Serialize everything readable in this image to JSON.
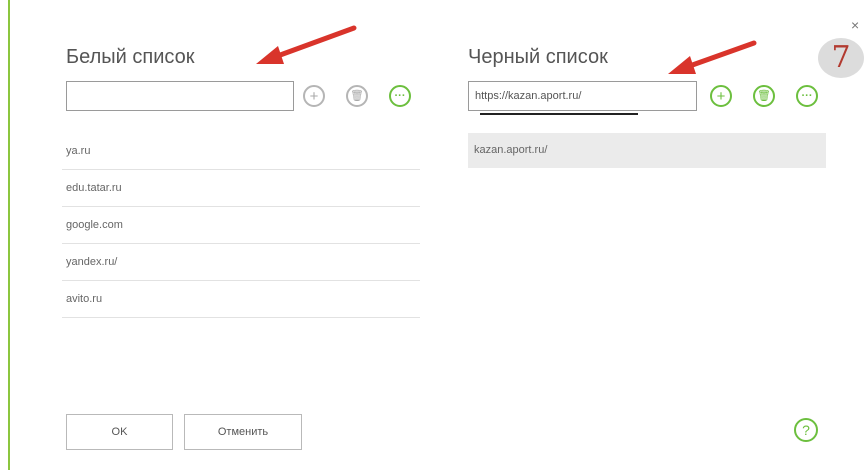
{
  "dialog": {
    "close_glyph": "×",
    "step_number": "7",
    "ok_label": "OK",
    "cancel_label": "Отменить",
    "help_glyph": "?"
  },
  "white_list": {
    "title": "Белый список",
    "input_value": "",
    "add_glyph": "+",
    "delete_glyph": "🗑",
    "more_glyph": "···",
    "items": [
      "ya.ru",
      "edu.tatar.ru",
      "google.com",
      "yandex.ru/",
      "avito.ru"
    ]
  },
  "black_list": {
    "title": "Черный список",
    "input_value": "https://kazan.aport.ru/",
    "add_glyph": "+",
    "delete_glyph": "🗑",
    "more_glyph": "···",
    "items": [
      "kazan.aport.ru/"
    ]
  },
  "icons": {
    "add": "plus-circle-icon",
    "delete": "trash-icon",
    "more": "more-dots-icon",
    "help": "question-circle-icon",
    "close": "close-icon"
  },
  "colors": {
    "accent_green": "#6cbf3e",
    "annotation_red": "#d9342b",
    "selected_row": "#ebebeb"
  }
}
